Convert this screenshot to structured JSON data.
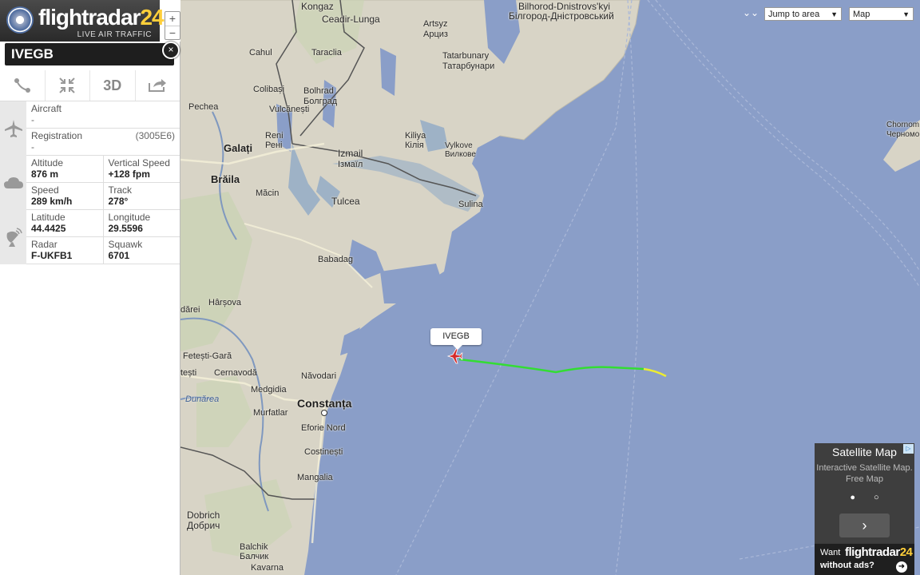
{
  "logo": {
    "brand": "flightradar",
    "brand_num": "24",
    "tagline": "LIVE AIR TRAFFIC"
  },
  "zoom": {
    "plus": "+",
    "minus": "−"
  },
  "flight": {
    "callsign": "IVEGB",
    "close_glyph": "×",
    "tools": {
      "route_icon": "route-icon",
      "collapse_icon": "collapse-arrows-icon",
      "view3d": "3D",
      "share_icon": "share-icon"
    },
    "aircraft": {
      "label": "Aircraft",
      "value": "-"
    },
    "registration": {
      "label": "Registration",
      "value": "-",
      "code": "(3005E6)"
    },
    "altitude": {
      "label": "Altitude",
      "value": "876 m"
    },
    "vertical_speed": {
      "label": "Vertical Speed",
      "value": "+128 fpm"
    },
    "speed": {
      "label": "Speed",
      "value": "289 km/h"
    },
    "track": {
      "label": "Track",
      "value": "278°"
    },
    "latitude": {
      "label": "Latitude",
      "value": "44.4425"
    },
    "longitude": {
      "label": "Longitude",
      "value": "29.5596"
    },
    "radar": {
      "label": "Radar",
      "value": "F-UKFB1"
    },
    "squawk": {
      "label": "Squawk",
      "value": "6701"
    },
    "icons": [
      "plane-icon",
      "cloud-icon",
      "radar-dish-icon"
    ]
  },
  "controls": {
    "collapse": "⌄⌄",
    "jump": "Jump to area",
    "maptype": "Map",
    "arrow": "▼"
  },
  "map": {
    "marker_label": "IVEGB",
    "places": [
      {
        "id": "kongaz",
        "text": "Kongaz"
      },
      {
        "id": "ceadir",
        "text": "Ceadir-Lunga"
      },
      {
        "id": "artsyz",
        "text": "Artsyz"
      },
      {
        "id": "artsyz_c",
        "text": "Арциз"
      },
      {
        "id": "bilhorod",
        "text": "Bilhorod-Dnistrovs'kyi"
      },
      {
        "id": "bilhorod_c",
        "text": "Білгород-Дністровський"
      },
      {
        "id": "cahul",
        "text": "Cahul"
      },
      {
        "id": "taraclia",
        "text": "Taraclia"
      },
      {
        "id": "tatarbunary",
        "text": "Tatarbunary"
      },
      {
        "id": "tatarbunary_c",
        "text": "Татарбунари"
      },
      {
        "id": "colibasi",
        "text": "Colibași"
      },
      {
        "id": "bolhrad",
        "text": "Bolhrad"
      },
      {
        "id": "bolhrad_c",
        "text": "Болград"
      },
      {
        "id": "pechea",
        "text": "Pechea"
      },
      {
        "id": "vulcanesti",
        "text": "Vulcănești"
      },
      {
        "id": "chornom",
        "text": "Chornom"
      },
      {
        "id": "chornom_c",
        "text": "Черномо"
      },
      {
        "id": "reni",
        "text": "Reni"
      },
      {
        "id": "reni_c",
        "text": "Рені"
      },
      {
        "id": "kiliya",
        "text": "Kiliya"
      },
      {
        "id": "kiliya_c",
        "text": "Кілія"
      },
      {
        "id": "galati",
        "text": "Galați"
      },
      {
        "id": "izmail",
        "text": "Izmail"
      },
      {
        "id": "izmail_c",
        "text": "Ізмаїл"
      },
      {
        "id": "vylkove",
        "text": "Vylkove"
      },
      {
        "id": "vylkove_c",
        "text": "Вилкове"
      },
      {
        "id": "braila",
        "text": "Brăila"
      },
      {
        "id": "macin",
        "text": "Măcin"
      },
      {
        "id": "tulcea",
        "text": "Tulcea"
      },
      {
        "id": "sulina",
        "text": "Sulina"
      },
      {
        "id": "babadag",
        "text": "Babadag"
      },
      {
        "id": "darei",
        "text": "dărei"
      },
      {
        "id": "harsova",
        "text": "Hârșova"
      },
      {
        "id": "fetesti",
        "text": "Fetești-Gară"
      },
      {
        "id": "tesri",
        "text": "tești"
      },
      {
        "id": "cernavoda",
        "text": "Cernavodă"
      },
      {
        "id": "navodari",
        "text": "Năvodari"
      },
      {
        "id": "medgidia",
        "text": "Medgidia"
      },
      {
        "id": "dunarea",
        "text": "Dunărea"
      },
      {
        "id": "constanta",
        "text": "Constanța"
      },
      {
        "id": "murfatlar",
        "text": "Murfatlar"
      },
      {
        "id": "eforie",
        "text": "Eforie Nord"
      },
      {
        "id": "costinesti",
        "text": "Costinești"
      },
      {
        "id": "mangalia",
        "text": "Mangalia"
      },
      {
        "id": "dobrich",
        "text": "Dobrich"
      },
      {
        "id": "dobrich_c",
        "text": "Добрич"
      },
      {
        "id": "balchik",
        "text": "Balchik"
      },
      {
        "id": "balchik_c",
        "text": "Балчик"
      },
      {
        "id": "kavarna",
        "text": "Kavarna"
      }
    ]
  },
  "ad": {
    "title": "Satellite Map",
    "desc": "Interactive Satellite Map. Free Map",
    "dots": "● ○",
    "next": "›",
    "choice": "▷",
    "want": "Want",
    "brand": "flightradar",
    "brand_num": "24",
    "without": "without ads?",
    "go": "➜"
  }
}
